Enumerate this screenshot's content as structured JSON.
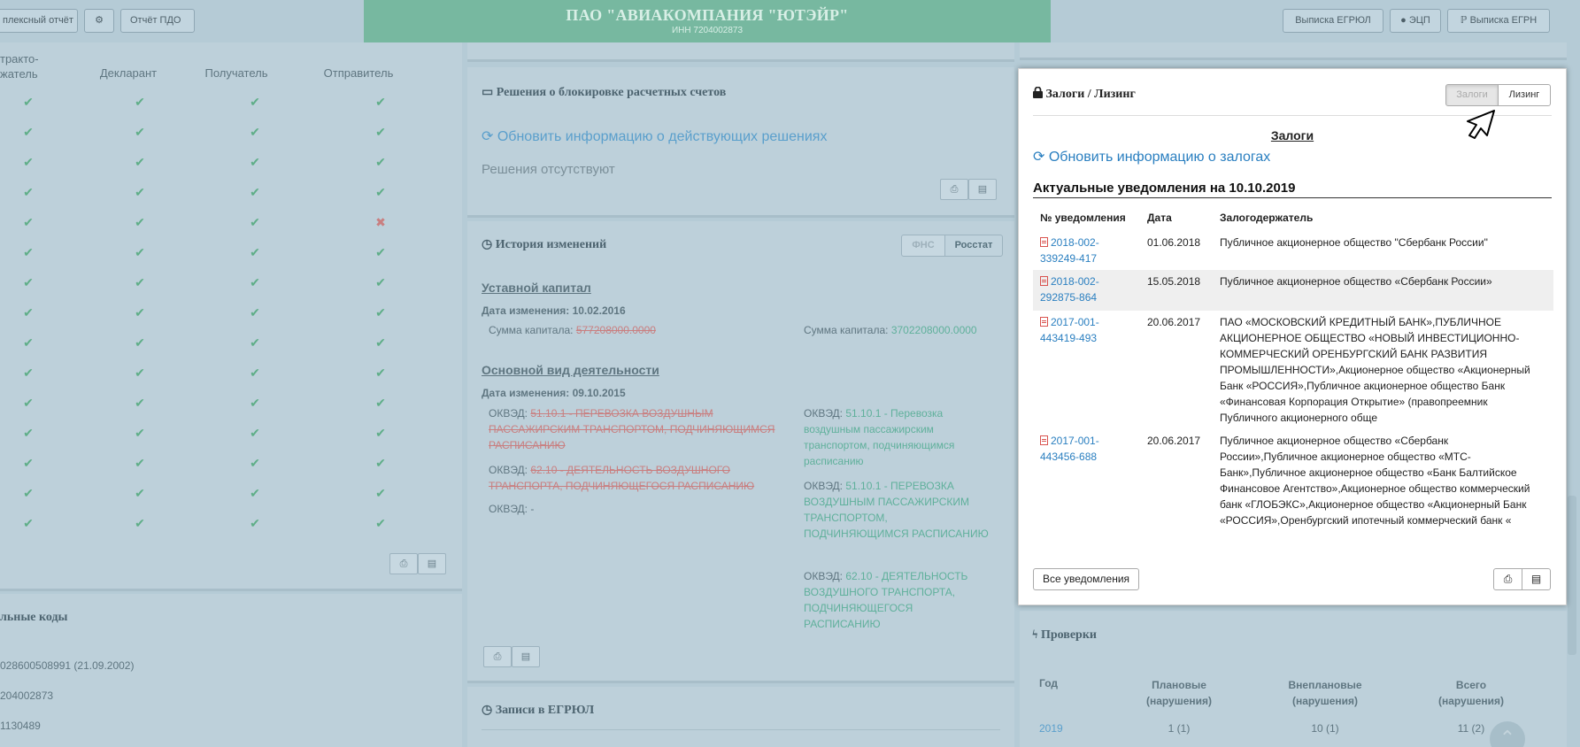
{
  "topbar": {
    "left_buttons": [
      "плексный отчёт",
      "⚙",
      "Отчёт ПДО"
    ],
    "company_name": "ПАО \"АВИАКОМПАНИЯ \"ЮТЭЙР\"",
    "company_inn": "ИНН 7204002873",
    "right_buttons": [
      "Выписка ЕГРЮЛ",
      "ЭЦП",
      "Выписка ЕГРН"
    ]
  },
  "left_panel": {
    "columns": [
      "тракто-\nжатель",
      "Декларант",
      "Получатель",
      "Отправитель"
    ],
    "rows": [
      [
        "✔",
        "✔",
        "✔",
        "✔"
      ],
      [
        "✔",
        "✔",
        "✔",
        "✔"
      ],
      [
        "✔",
        "✔",
        "✔",
        "✔"
      ],
      [
        "✔",
        "✔",
        "✔",
        "✔"
      ],
      [
        "✔",
        "✔",
        "✔",
        "✖"
      ],
      [
        "✔",
        "✔",
        "✔",
        "✔"
      ],
      [
        "✔",
        "✔",
        "✔",
        "✔"
      ],
      [
        "✔",
        "✔",
        "✔",
        "✔"
      ],
      [
        "✔",
        "✔",
        "✔",
        "✔"
      ],
      [
        "✔",
        "✔",
        "✔",
        "✔"
      ],
      [
        "✔",
        "✔",
        "✔",
        "✔"
      ],
      [
        "✔",
        "✔",
        "✔",
        "✔"
      ],
      [
        "✔",
        "✔",
        "✔",
        "✔"
      ],
      [
        "✔",
        "✔",
        "✔",
        "✔"
      ],
      [
        "✔",
        "✔",
        "✔",
        "✔"
      ]
    ],
    "codes_title": "льные коды",
    "codes": [
      "028600508991 (21.09.2002)",
      "204002873",
      "1130489"
    ]
  },
  "blocking": {
    "title": "Решения о блокировке расчетных счетов",
    "refresh": "Обновить информацию о действующих решениях",
    "empty": "Решения отсутствуют"
  },
  "history": {
    "title": "История изменений",
    "tabs": [
      "ФНС",
      "Росстат"
    ],
    "capital_title": "Уставной капитал",
    "capital_date": "Дата изменения: 10.02.2016",
    "capital_old_label": "Сумма капитала:",
    "capital_old": "577208000.0000",
    "capital_new_label": "Сумма капитала:",
    "capital_new": "3702208000.0000",
    "activity_title": "Основной вид деятельности",
    "activity_date": "Дата изменения: 09.10.2015",
    "okved_label": "ОКВЭД:",
    "old_items": [
      "51.10.1 - ПЕРЕВОЗКА ВОЗДУШНЫМ ПАССАЖИРСКИМ ТРАНСПОРТОМ, ПОДЧИНЯЮЩИМСЯ РАСПИСАНИЮ",
      "62.10 - ДЕЯТЕЛЬНОСТЬ ВОЗДУШНОГО ТРАНСПОРТА, ПОДЧИНЯЮЩЕГОСЯ РАСПИСАНИЮ",
      "-"
    ],
    "new_items": [
      "51.10.1 - Перевозка воздушным пассажирским транспортом, подчиняющимся расписанию",
      "51.10.1 - ПЕРЕВОЗКА ВОЗДУШНЫМ ПАССАЖИРСКИМ ТРАНСПОРТОМ, ПОДЧИНЯЮЩИМСЯ РАСПИСАНИЮ",
      "62.10 - ДЕЯТЕЛЬНОСТЬ ВОЗДУШНОГО ТРАНСПОРТА, ПОДЧИНЯЮЩЕГОСЯ РАСПИСАНИЮ"
    ]
  },
  "egrul": {
    "title": "Записи в ЕГРЮЛ"
  },
  "checks": {
    "title": "Проверки",
    "headers": [
      "Год",
      "Плановые\n(нарушения)",
      "Внеплановые\n(нарушения)",
      "Всего\n(нарушения)"
    ],
    "row": [
      "2019",
      "1 (1)",
      "10 (1)",
      "11 (2)"
    ]
  },
  "modal": {
    "title": "Залоги / Лизинг",
    "toggle": [
      "Залоги",
      "Лизинг"
    ],
    "section_title": "Залоги",
    "refresh": "Обновить информацию о залогах",
    "notices_title": "Актуальные уведомления на 10.10.2019",
    "columns": [
      "№ уведомления",
      "Дата",
      "Залогодержатель"
    ],
    "rows": [
      {
        "num": "2018-002-339249-417",
        "date": "01.06.2018",
        "holder": "Публичное акционерное общество \"Сбербанк России\""
      },
      {
        "num": "2018-002-292875-864",
        "date": "15.05.2018",
        "holder": "Публичное акционерное общество «Сбербанк России»"
      },
      {
        "num": "2017-001-443419-493",
        "date": "20.06.2017",
        "holder": "ПАО «МОСКОВСКИЙ КРЕДИТНЫЙ БАНК»,ПУБЛИЧНОЕ АКЦИОНЕРНОЕ ОБЩЕСТВО «НОВЫЙ ИНВЕСТИЦИОННО-КОММЕРЧЕСКИЙ ОРЕНБУРГСКИЙ БАНК РАЗВИТИЯ ПРОМЫШЛЕННОСТИ»,Акционерное общество «Акционерный Банк «РОССИЯ»,Публичное акционерное общество Банк «Финансовая Корпорация Открытие» (правопреемник Публичного акционерного обще"
      },
      {
        "num": "2017-001-443456-688",
        "date": "20.06.2017",
        "holder": "Публичное акционерное общество «Сбербанк России»,Публичное акционерное общество «МТС-Банк»,Публичное акционерное общество «Банк Балтийское Финансовое Агентство»,Акционерное общество коммерческий банк «ГЛОБЭКС»,Акционерное общество «Акционерный Банк «РОССИЯ»,Оренбургский ипотечный коммерческий банк «"
      }
    ],
    "all_button": "Все уведомления"
  }
}
